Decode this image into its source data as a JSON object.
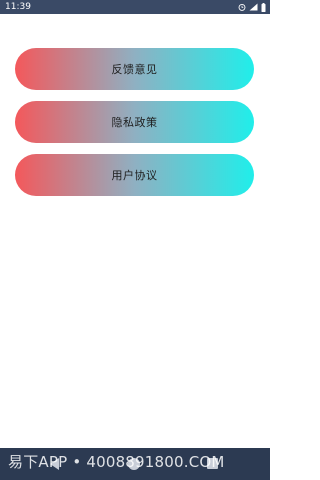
{
  "status_bar": {
    "time": "11:39",
    "icons": [
      "alarm-icon",
      "signal-icon",
      "battery-icon"
    ]
  },
  "menu": {
    "items": [
      {
        "label": "反馈意见"
      },
      {
        "label": "隐私政策"
      },
      {
        "label": "用户协议"
      }
    ]
  },
  "colors": {
    "gradient_start": "#f4585b",
    "gradient_end": "#20eeea",
    "status_bar_bg": "#3a4a66",
    "nav_bar_bg": "#2c3a52"
  },
  "watermark": {
    "text": "易下APP • 4008891800.COM"
  }
}
